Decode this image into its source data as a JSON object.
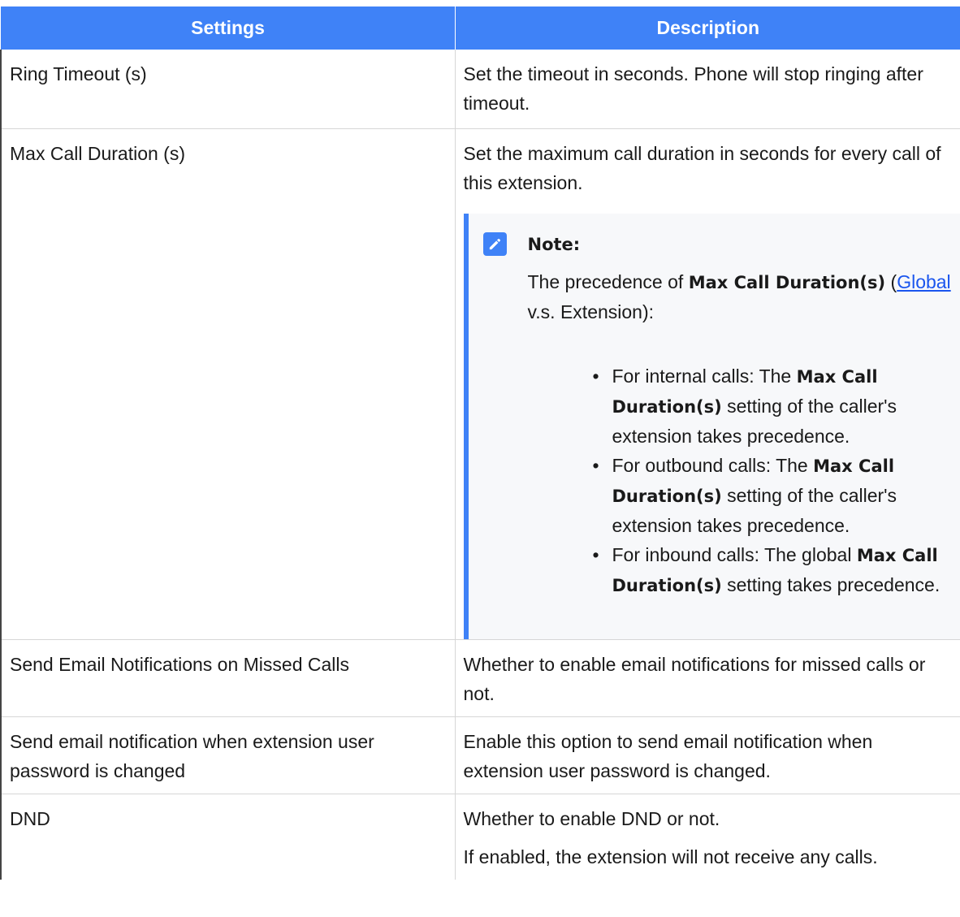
{
  "table": {
    "headers": [
      "Settings",
      "Description"
    ],
    "rows": [
      {
        "setting": "Ring Timeout (s)",
        "desc": [
          "Set the timeout in seconds. Phone will stop ringing after timeout."
        ]
      },
      {
        "setting": "Max Call Duration (s)",
        "desc": [
          "Set the maximum call duration in seconds for every call of this extension."
        ],
        "note": {
          "title": "Note:",
          "intro_prefix": "The precedence of ",
          "intro_bold": "Max Call Duration(s)",
          "intro_open": " (",
          "link": "Global",
          "intro_suffix": " v.s. Extension):",
          "bullet": "•",
          "items": [
            {
              "prefix": "For internal calls: The ",
              "bold": "Max Call Duration(s)",
              "suffix": " setting of the caller's extension takes precedence."
            },
            {
              "prefix": "For outbound calls: The ",
              "bold": "Max Call Duration(s)",
              "suffix": " setting of the caller's extension takes precedence."
            },
            {
              "prefix": "For inbound calls: The global ",
              "bold": "Max Call Duration(s)",
              "suffix": " setting takes precedence."
            }
          ]
        }
      },
      {
        "setting": "Send Email Notifications on Missed Calls",
        "desc": [
          "Whether to enable email notifications for missed calls or not."
        ]
      },
      {
        "setting": "Send email notification when extension user password is changed",
        "desc": [
          "Enable this option to send email notification when extension user password is changed."
        ]
      },
      {
        "setting": "DND",
        "desc": [
          "Whether to enable DND or not.",
          "If enabled, the extension will not receive any calls."
        ]
      }
    ]
  },
  "colors": {
    "header_bg": "#3f82f7",
    "note_accent": "#3f82f7",
    "link": "#1a55ee"
  },
  "icons": {
    "note": "pencil-icon"
  }
}
